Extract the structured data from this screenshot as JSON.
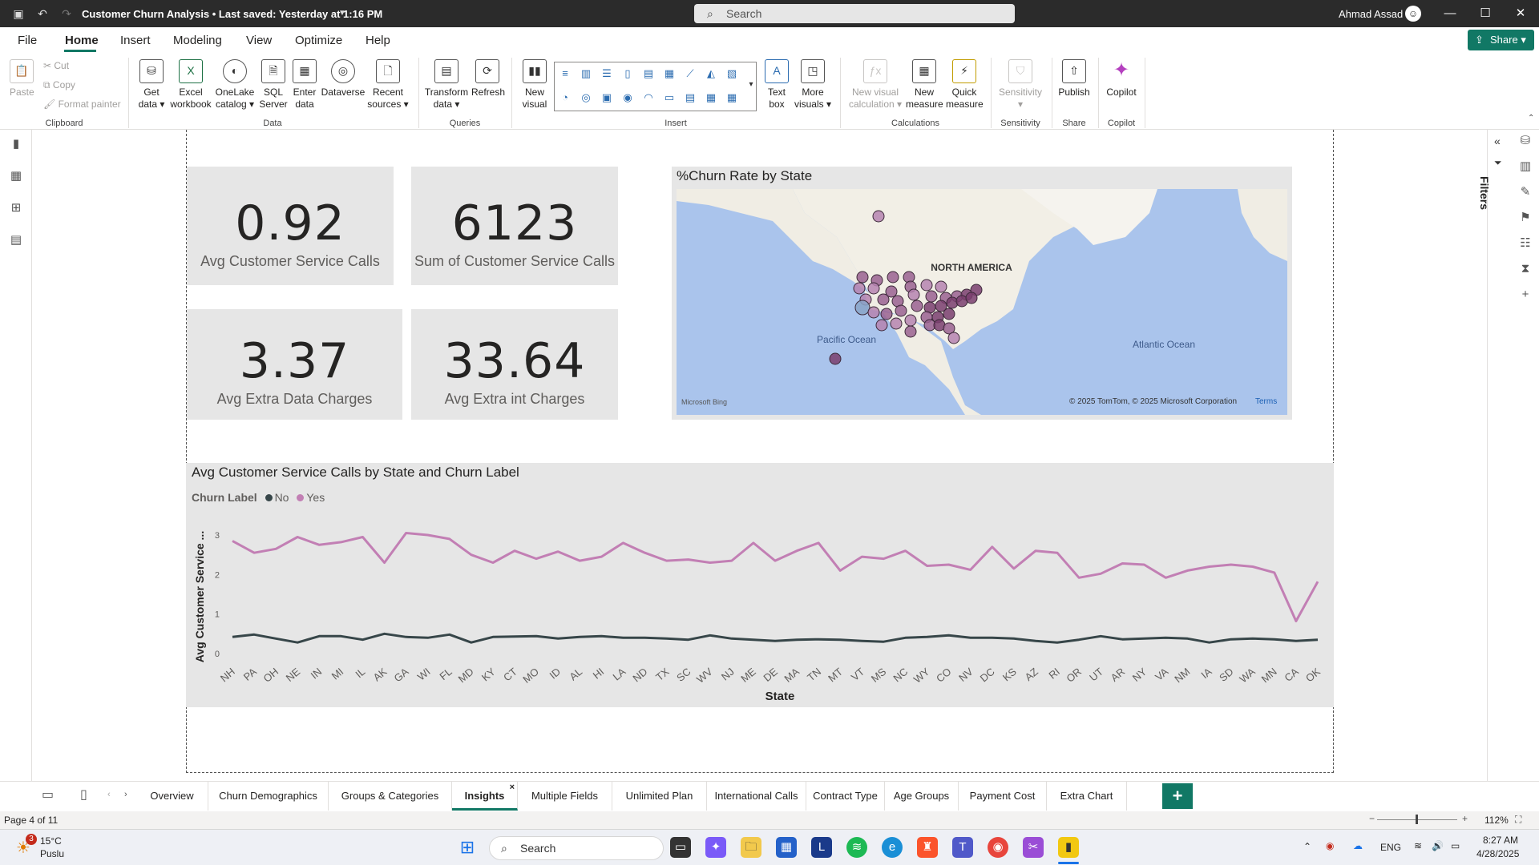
{
  "titlebar": {
    "title": "Customer Churn Analysis • Last saved: Yesterday at 1:16 PM",
    "search_placeholder": "Search",
    "user": "Ahmad Assad"
  },
  "menu": {
    "tabs": [
      "File",
      "Home",
      "Insert",
      "Modeling",
      "View",
      "Optimize",
      "Help"
    ],
    "active": "Home",
    "share_label": "Share"
  },
  "ribbon": {
    "clipboard": {
      "paste": "Paste",
      "cut": "Cut",
      "copy": "Copy",
      "format_painter": "Format painter",
      "group": "Clipboard"
    },
    "data": {
      "get_data": "Get data",
      "excel": "Excel workbook",
      "onelake": "OneLake catalog",
      "sql": "SQL Server",
      "enter_data": "Enter data",
      "dataverse": "Dataverse",
      "recent": "Recent sources",
      "group": "Data"
    },
    "queries": {
      "transform": "Transform data",
      "refresh": "Refresh",
      "group": "Queries"
    },
    "insert": {
      "new_visual": "New visual",
      "text_box": "Text box",
      "more_visuals": "More visuals",
      "group": "Insert"
    },
    "calculations": {
      "new_visual_calc": "New visual calculation",
      "new_measure": "New measure",
      "quick_measure": "Quick measure",
      "group": "Calculations"
    },
    "sensitivity": {
      "label": "Sensitivity",
      "group": "Sensitivity"
    },
    "share": {
      "publish": "Publish",
      "group": "Share"
    },
    "copilot": {
      "label": "Copilot",
      "group": "Copilot"
    }
  },
  "cards": [
    {
      "value": "0.92",
      "label": "Avg Customer Service Calls"
    },
    {
      "value": "6123",
      "label": "Sum of Customer Service Calls"
    },
    {
      "value": "3.37",
      "label": "Avg Extra Data Charges"
    },
    {
      "value": "33.64",
      "label": "Avg Extra int Charges"
    }
  ],
  "map": {
    "title": "%Churn Rate by State",
    "labels": {
      "continent": "NORTH AMERICA",
      "pacific": "Pacific Ocean",
      "atlantic": "Atlantic Ocean"
    },
    "credit": "Microsoft Bing",
    "copyright": "© 2025 TomTom, © 2025 Microsoft Corporation",
    "terms": "Terms",
    "bubble_colors": {
      "light": "#b684b0",
      "mid": "#9a6190",
      "dark": "#7a3e6e",
      "blue": "#8aa4c8"
    }
  },
  "filters_label": "Filters",
  "chart_data": {
    "type": "line",
    "title": "Avg Customer Service Calls by State and Churn Label",
    "legend_title": "Churn Label",
    "xlabel": "State",
    "ylabel": "Avg Customer Service ...",
    "ylim": [
      0,
      3
    ],
    "y_ticks": [
      0,
      1,
      2,
      3
    ],
    "categories": [
      "NH",
      "PA",
      "OH",
      "NE",
      "IN",
      "MI",
      "IL",
      "AK",
      "GA",
      "WI",
      "FL",
      "MD",
      "KY",
      "CT",
      "MO",
      "ID",
      "AL",
      "HI",
      "LA",
      "ND",
      "TX",
      "SC",
      "WV",
      "NJ",
      "ME",
      "DE",
      "MA",
      "TN",
      "MT",
      "VT",
      "MS",
      "NC",
      "WY",
      "CO",
      "NV",
      "DC",
      "KS",
      "AZ",
      "RI",
      "OR",
      "UT",
      "AR",
      "NY",
      "VA",
      "NM",
      "IA",
      "SD",
      "WA",
      "MN",
      "CA",
      "OK"
    ],
    "series": [
      {
        "name": "No",
        "color": "#374649",
        "values": [
          0.42,
          0.48,
          0.38,
          0.28,
          0.44,
          0.44,
          0.35,
          0.5,
          0.42,
          0.4,
          0.48,
          0.28,
          0.42,
          0.43,
          0.44,
          0.38,
          0.42,
          0.44,
          0.4,
          0.4,
          0.38,
          0.35,
          0.46,
          0.38,
          0.35,
          0.32,
          0.35,
          0.36,
          0.35,
          0.32,
          0.3,
          0.4,
          0.42,
          0.46,
          0.4,
          0.4,
          0.38,
          0.32,
          0.28,
          0.35,
          0.44,
          0.36,
          0.38,
          0.4,
          0.38,
          0.28,
          0.36,
          0.38,
          0.36,
          0.32,
          0.35
        ]
      },
      {
        "name": "Yes",
        "color": "#c27fb4",
        "values": [
          2.85,
          2.55,
          2.65,
          2.95,
          2.75,
          2.82,
          2.95,
          2.3,
          3.05,
          3.0,
          2.9,
          2.5,
          2.3,
          2.6,
          2.4,
          2.58,
          2.35,
          2.45,
          2.8,
          2.55,
          2.35,
          2.38,
          2.3,
          2.35,
          2.8,
          2.35,
          2.6,
          2.8,
          2.1,
          2.45,
          2.4,
          2.6,
          2.22,
          2.25,
          2.12,
          2.7,
          2.15,
          2.6,
          2.55,
          1.92,
          2.02,
          2.28,
          2.25,
          1.92,
          2.1,
          2.2,
          2.25,
          2.2,
          2.05,
          0.82,
          1.82
        ]
      }
    ]
  },
  "pages": {
    "tabs": [
      "Overview",
      "Churn Demographics",
      "Groups & Categories",
      "Insights",
      "Multiple Fields",
      "Unlimited Plan",
      "International Calls",
      "Contract Type",
      "Age Groups",
      "Payment Cost",
      "Extra Chart"
    ],
    "active": "Insights",
    "close_icon": "×",
    "add_icon": "+"
  },
  "status": {
    "page_indicator": "Page 4 of 11",
    "zoom": "112%"
  },
  "taskbar": {
    "weather_temp": "15°C",
    "weather_desc": "Puslu",
    "weather_badge": "3",
    "search_placeholder": "Search",
    "language": "ENG",
    "time": "8:27 AM",
    "date": "4/28/2025"
  }
}
